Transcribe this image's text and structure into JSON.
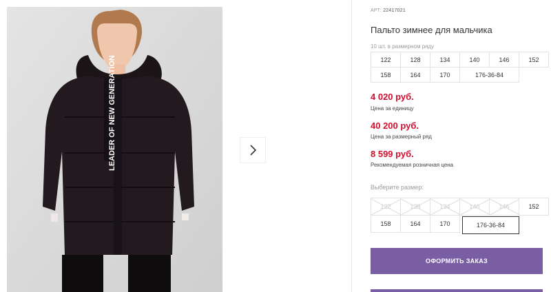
{
  "product": {
    "art_label": "АРТ:",
    "art_value": "22417021",
    "title": "Пальто зимнее для мальчика",
    "pack_note": "10 шт. в размерном ряду",
    "photo_print_text": "LEADER OF NEW GENERATION"
  },
  "pack_sizes": [
    "122",
    "128",
    "134",
    "140",
    "146",
    "152",
    "158",
    "164",
    "170",
    "176-36-84"
  ],
  "prices": [
    {
      "value": "4 020 руб.",
      "note": "Цена за единицу"
    },
    {
      "value": "40 200 руб.",
      "note": "Цена за размерный ряд"
    },
    {
      "value": "8 599 руб.",
      "note": "Рекомендуемая розничная цена"
    }
  ],
  "size_select": {
    "label": "Выберите размер:",
    "options": [
      "122",
      "128",
      "134",
      "140",
      "146",
      "152",
      "158",
      "164",
      "170",
      "176-36-84"
    ],
    "selected": "176-36-84"
  },
  "actions": {
    "order_label": "ОФОРМИТЬ ЗАКАЗ"
  },
  "colors": {
    "accent": "#7a5ea3",
    "price": "#d0102f"
  },
  "icons": {
    "next": "chevron-right-icon"
  }
}
